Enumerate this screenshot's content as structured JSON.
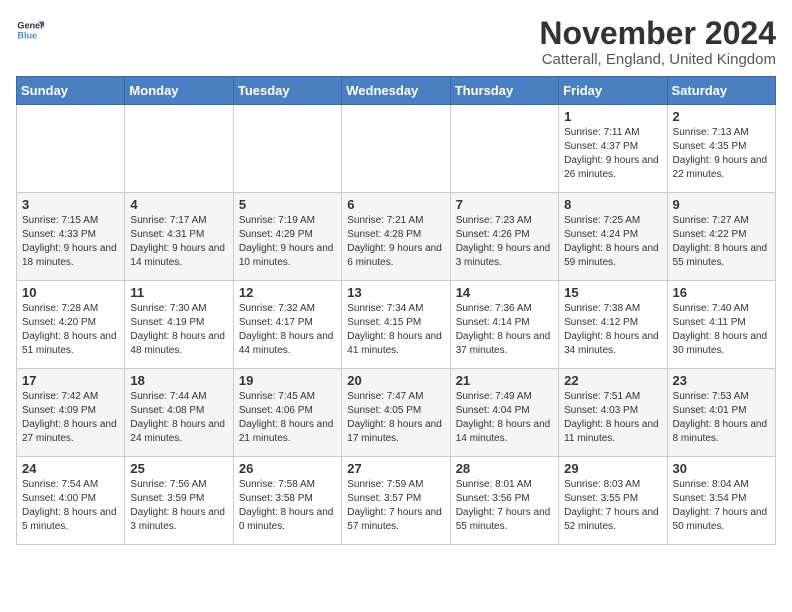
{
  "logo": {
    "general": "General",
    "blue": "Blue"
  },
  "title": "November 2024",
  "subtitle": "Catterall, England, United Kingdom",
  "days_of_week": [
    "Sunday",
    "Monday",
    "Tuesday",
    "Wednesday",
    "Thursday",
    "Friday",
    "Saturday"
  ],
  "weeks": [
    [
      {
        "day": "",
        "info": ""
      },
      {
        "day": "",
        "info": ""
      },
      {
        "day": "",
        "info": ""
      },
      {
        "day": "",
        "info": ""
      },
      {
        "day": "",
        "info": ""
      },
      {
        "day": "1",
        "info": "Sunrise: 7:11 AM\nSunset: 4:37 PM\nDaylight: 9 hours and 26 minutes."
      },
      {
        "day": "2",
        "info": "Sunrise: 7:13 AM\nSunset: 4:35 PM\nDaylight: 9 hours and 22 minutes."
      }
    ],
    [
      {
        "day": "3",
        "info": "Sunrise: 7:15 AM\nSunset: 4:33 PM\nDaylight: 9 hours and 18 minutes."
      },
      {
        "day": "4",
        "info": "Sunrise: 7:17 AM\nSunset: 4:31 PM\nDaylight: 9 hours and 14 minutes."
      },
      {
        "day": "5",
        "info": "Sunrise: 7:19 AM\nSunset: 4:29 PM\nDaylight: 9 hours and 10 minutes."
      },
      {
        "day": "6",
        "info": "Sunrise: 7:21 AM\nSunset: 4:28 PM\nDaylight: 9 hours and 6 minutes."
      },
      {
        "day": "7",
        "info": "Sunrise: 7:23 AM\nSunset: 4:26 PM\nDaylight: 9 hours and 3 minutes."
      },
      {
        "day": "8",
        "info": "Sunrise: 7:25 AM\nSunset: 4:24 PM\nDaylight: 8 hours and 59 minutes."
      },
      {
        "day": "9",
        "info": "Sunrise: 7:27 AM\nSunset: 4:22 PM\nDaylight: 8 hours and 55 minutes."
      }
    ],
    [
      {
        "day": "10",
        "info": "Sunrise: 7:28 AM\nSunset: 4:20 PM\nDaylight: 8 hours and 51 minutes."
      },
      {
        "day": "11",
        "info": "Sunrise: 7:30 AM\nSunset: 4:19 PM\nDaylight: 8 hours and 48 minutes."
      },
      {
        "day": "12",
        "info": "Sunrise: 7:32 AM\nSunset: 4:17 PM\nDaylight: 8 hours and 44 minutes."
      },
      {
        "day": "13",
        "info": "Sunrise: 7:34 AM\nSunset: 4:15 PM\nDaylight: 8 hours and 41 minutes."
      },
      {
        "day": "14",
        "info": "Sunrise: 7:36 AM\nSunset: 4:14 PM\nDaylight: 8 hours and 37 minutes."
      },
      {
        "day": "15",
        "info": "Sunrise: 7:38 AM\nSunset: 4:12 PM\nDaylight: 8 hours and 34 minutes."
      },
      {
        "day": "16",
        "info": "Sunrise: 7:40 AM\nSunset: 4:11 PM\nDaylight: 8 hours and 30 minutes."
      }
    ],
    [
      {
        "day": "17",
        "info": "Sunrise: 7:42 AM\nSunset: 4:09 PM\nDaylight: 8 hours and 27 minutes."
      },
      {
        "day": "18",
        "info": "Sunrise: 7:44 AM\nSunset: 4:08 PM\nDaylight: 8 hours and 24 minutes."
      },
      {
        "day": "19",
        "info": "Sunrise: 7:45 AM\nSunset: 4:06 PM\nDaylight: 8 hours and 21 minutes."
      },
      {
        "day": "20",
        "info": "Sunrise: 7:47 AM\nSunset: 4:05 PM\nDaylight: 8 hours and 17 minutes."
      },
      {
        "day": "21",
        "info": "Sunrise: 7:49 AM\nSunset: 4:04 PM\nDaylight: 8 hours and 14 minutes."
      },
      {
        "day": "22",
        "info": "Sunrise: 7:51 AM\nSunset: 4:03 PM\nDaylight: 8 hours and 11 minutes."
      },
      {
        "day": "23",
        "info": "Sunrise: 7:53 AM\nSunset: 4:01 PM\nDaylight: 8 hours and 8 minutes."
      }
    ],
    [
      {
        "day": "24",
        "info": "Sunrise: 7:54 AM\nSunset: 4:00 PM\nDaylight: 8 hours and 5 minutes."
      },
      {
        "day": "25",
        "info": "Sunrise: 7:56 AM\nSunset: 3:59 PM\nDaylight: 8 hours and 3 minutes."
      },
      {
        "day": "26",
        "info": "Sunrise: 7:58 AM\nSunset: 3:58 PM\nDaylight: 8 hours and 0 minutes."
      },
      {
        "day": "27",
        "info": "Sunrise: 7:59 AM\nSunset: 3:57 PM\nDaylight: 7 hours and 57 minutes."
      },
      {
        "day": "28",
        "info": "Sunrise: 8:01 AM\nSunset: 3:56 PM\nDaylight: 7 hours and 55 minutes."
      },
      {
        "day": "29",
        "info": "Sunrise: 8:03 AM\nSunset: 3:55 PM\nDaylight: 7 hours and 52 minutes."
      },
      {
        "day": "30",
        "info": "Sunrise: 8:04 AM\nSunset: 3:54 PM\nDaylight: 7 hours and 50 minutes."
      }
    ]
  ]
}
